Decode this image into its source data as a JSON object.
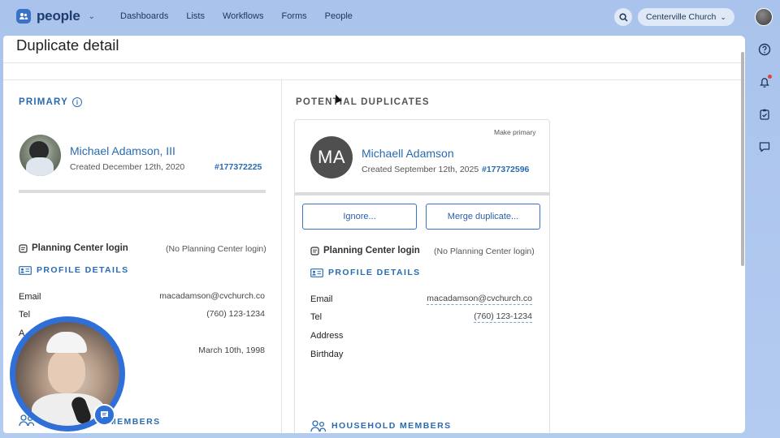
{
  "app": {
    "name": "people"
  },
  "nav": {
    "items": [
      "Dashboards",
      "Lists",
      "Workflows",
      "Forms",
      "People"
    ]
  },
  "org": {
    "name": "Centerville Church"
  },
  "page": {
    "title": "Duplicate detail"
  },
  "primary": {
    "heading": "PRIMARY",
    "name": "Michael Adamson, III",
    "created": "Created December 12th, 2020",
    "id": "#177372225",
    "login_label": "Planning Center login",
    "login_value": "(No Planning Center login)",
    "profile_heading": "PROFILE DETAILS",
    "fields": [
      {
        "label": "Email",
        "value": "macadamson@cvchurch.co"
      },
      {
        "label": "Tel",
        "value": "(760) 123-1234"
      },
      {
        "label": "A",
        "value": ""
      },
      {
        "label": "",
        "value": "March 10th, 1998"
      }
    ],
    "household_heading": "MEMBERS"
  },
  "duplicates": {
    "heading": "POTENTIAL DUPLICATES",
    "make_primary": "Make primary",
    "initials": "MA",
    "name": "Michaell Adamson",
    "created": "Created September 12th, 2025",
    "id": "#177372596",
    "ignore_label": "Ignore...",
    "merge_label": "Merge duplicate...",
    "login_label": "Planning Center login",
    "login_value": "(No Planning Center login)",
    "profile_heading": "PROFILE DETAILS",
    "fields": [
      {
        "label": "Email",
        "value": "macadamson@cvchurch.co"
      },
      {
        "label": "Tel",
        "value": "(760) 123-1234"
      },
      {
        "label": "Address",
        "value": ""
      },
      {
        "label": "Birthday",
        "value": ""
      }
    ],
    "household_heading": "HOUSEHOLD MEMBERS"
  },
  "colors": {
    "accent": "#2a6bb0",
    "brand": "#3a72c7",
    "background": "#a9c3ec"
  },
  "icons": [
    "people-logo-icon",
    "search-icon",
    "help-icon",
    "bell-icon",
    "clipboard-check-icon",
    "chat-icon",
    "info-icon",
    "login-icon",
    "profile-card-icon",
    "household-icon"
  ]
}
